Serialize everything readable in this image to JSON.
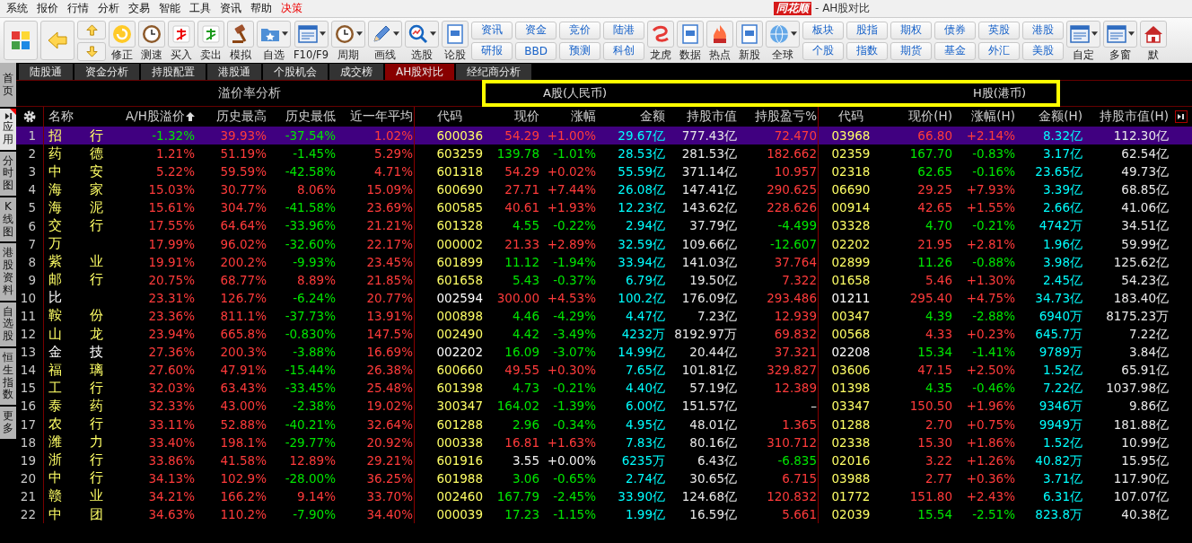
{
  "menu": [
    {
      "label": "系统",
      "highlight": false
    },
    {
      "label": "报价",
      "highlight": false
    },
    {
      "label": "行情",
      "highlight": false
    },
    {
      "label": "分析",
      "highlight": false
    },
    {
      "label": "交易",
      "highlight": false
    },
    {
      "label": "智能",
      "highlight": false
    },
    {
      "label": "工具",
      "highlight": false
    },
    {
      "label": "资讯",
      "highlight": false
    },
    {
      "label": "帮助",
      "highlight": false
    },
    {
      "label": "决策",
      "highlight": true
    }
  ],
  "title": {
    "logo": "同花顺",
    "text": "- AH股对比"
  },
  "toolbar": [
    {
      "kind": "icon"
    },
    {
      "kind": "icon"
    },
    {
      "kind": "updown"
    },
    {
      "kind": "icon",
      "label": "修正",
      "dropdown": false
    },
    {
      "kind": "icon",
      "label": "测速",
      "dropdown": false
    },
    {
      "kind": "icon",
      "label": "买入",
      "dropdown": false
    },
    {
      "kind": "icon",
      "label": "卖出",
      "dropdown": false
    },
    {
      "kind": "icon",
      "label": "模拟",
      "dropdown": false
    },
    {
      "kind": "icon",
      "label": "自选",
      "dropdown": true
    },
    {
      "kind": "icon",
      "label": "F10/F9",
      "dropdown": true
    },
    {
      "kind": "icon",
      "label": "周期",
      "dropdown": true
    },
    {
      "kind": "icon",
      "label": "画线",
      "dropdown": true
    },
    {
      "kind": "icon",
      "label": "选股",
      "dropdown": true
    },
    {
      "kind": "icon",
      "label": "论股",
      "dropdown": false
    },
    {
      "kind": "pair",
      "top": "资讯",
      "bottom": "研报"
    },
    {
      "kind": "pair",
      "top": "资金",
      "bottom": "BBD"
    },
    {
      "kind": "pair",
      "top": "竞价",
      "bottom": "预测"
    },
    {
      "kind": "pair",
      "top": "陆港",
      "bottom": "科创"
    },
    {
      "kind": "icon",
      "label": "龙虎",
      "dropdown": false
    },
    {
      "kind": "icon",
      "label": "数据",
      "dropdown": false
    },
    {
      "kind": "icon",
      "label": "热点",
      "dropdown": false
    },
    {
      "kind": "icon",
      "label": "新股",
      "dropdown": false
    },
    {
      "kind": "icon",
      "label": "全球",
      "dropdown": true
    },
    {
      "kind": "pair",
      "top": "板块",
      "bottom": "个股"
    },
    {
      "kind": "pair",
      "top": "股指",
      "bottom": "指数"
    },
    {
      "kind": "pair",
      "top": "期权",
      "bottom": "期货"
    },
    {
      "kind": "pair",
      "top": "债券",
      "bottom": "基金"
    },
    {
      "kind": "pair",
      "top": "英股",
      "bottom": "外汇"
    },
    {
      "kind": "pair",
      "top": "港股",
      "bottom": "美股"
    },
    {
      "kind": "icon",
      "label": "自定",
      "dropdown": true
    },
    {
      "kind": "icon",
      "label": "多窗",
      "dropdown": true
    },
    {
      "kind": "icon",
      "label": "默",
      "dropdown": false
    }
  ],
  "sidebar": [
    {
      "label": "首页",
      "selected": false
    },
    {
      "label": "应用",
      "selected": true
    },
    {
      "label": "分时图",
      "selected": false
    },
    {
      "label": "K线图",
      "selected": false
    },
    {
      "label": "港股资料",
      "selected": false
    },
    {
      "label": "自选股",
      "selected": false
    },
    {
      "label": "恒生指数",
      "selected": false
    },
    {
      "label": "更多",
      "selected": false
    }
  ],
  "tabs": [
    {
      "label": "陆股通",
      "selected": false
    },
    {
      "label": "资金分析",
      "selected": false
    },
    {
      "label": "持股配置",
      "selected": false
    },
    {
      "label": "港股通",
      "selected": false
    },
    {
      "label": "个股机会",
      "selected": false
    },
    {
      "label": "成交榜",
      "selected": false
    },
    {
      "label": "AH股对比",
      "selected": true
    },
    {
      "label": "经纪商分析",
      "selected": false
    }
  ],
  "band": {
    "title": "溢价率分析",
    "group_a": "A股(人民币)",
    "group_h": "H股(港币)"
  },
  "columns": [
    {
      "label": "名称",
      "sorted": false
    },
    {
      "label": "A/H股溢价",
      "sorted": true
    },
    {
      "label": "历史最高",
      "sorted": false
    },
    {
      "label": "历史最低",
      "sorted": false
    },
    {
      "label": "近一年平均",
      "sorted": false
    },
    {
      "label": "代码",
      "sorted": false
    },
    {
      "label": "现价",
      "sorted": false
    },
    {
      "label": "涨幅",
      "sorted": false
    },
    {
      "label": "金额",
      "sorted": false
    },
    {
      "label": "持股市值",
      "sorted": false
    },
    {
      "label": "持股盈亏%",
      "sorted": false
    },
    {
      "label": "代码",
      "sorted": false
    },
    {
      "label": "现价(H)",
      "sorted": false
    },
    {
      "label": "涨幅(H)",
      "sorted": false
    },
    {
      "label": "金额(H)",
      "sorted": false
    },
    {
      "label": "持股市值(H)",
      "sorted": false
    }
  ],
  "rows": [
    {
      "num": "1",
      "name_start": "招",
      "name_end": "行",
      "premium": "-1.32%",
      "hist_high": "39.93%",
      "hist_low": "-37.54%",
      "avg_1y": "1.02%",
      "a_code": "600036",
      "a_price": "54.29",
      "a_change": "+1.00%",
      "a_amount": "29.67亿",
      "a_mv": "777.43亿",
      "a_pnl": "72.470",
      "h_code": "03968",
      "h_price": "66.80",
      "h_change": "+2.14%",
      "h_amount": "8.32亿",
      "h_mv": "112.30亿",
      "tinted": true,
      "selected": true
    },
    {
      "num": "2",
      "name_start": "药",
      "name_end": "德",
      "premium": "1.21%",
      "hist_high": "51.19%",
      "hist_low": "-1.45%",
      "avg_1y": "5.29%",
      "a_code": "603259",
      "a_price": "139.78",
      "a_change": "-1.01%",
      "a_amount": "28.53亿",
      "a_mv": "281.53亿",
      "a_pnl": "182.662",
      "h_code": "02359",
      "h_price": "167.70",
      "h_change": "-0.83%",
      "h_amount": "3.17亿",
      "h_mv": "62.54亿",
      "tinted": true,
      "selected": false
    },
    {
      "num": "3",
      "name_start": "中",
      "name_end": "安",
      "premium": "5.22%",
      "hist_high": "59.59%",
      "hist_low": "-42.58%",
      "avg_1y": "4.71%",
      "a_code": "601318",
      "a_price": "54.29",
      "a_change": "+0.02%",
      "a_amount": "55.59亿",
      "a_mv": "371.14亿",
      "a_pnl": "10.957",
      "h_code": "02318",
      "h_price": "62.65",
      "h_change": "-0.16%",
      "h_amount": "23.65亿",
      "h_mv": "49.73亿",
      "tinted": true,
      "selected": false
    },
    {
      "num": "4",
      "name_start": "海",
      "name_end": "家",
      "premium": "15.03%",
      "hist_high": "30.77%",
      "hist_low": "8.06%",
      "avg_1y": "15.09%",
      "a_code": "600690",
      "a_price": "27.71",
      "a_change": "+7.44%",
      "a_amount": "26.08亿",
      "a_mv": "147.41亿",
      "a_pnl": "290.625",
      "h_code": "06690",
      "h_price": "29.25",
      "h_change": "+7.93%",
      "h_amount": "3.39亿",
      "h_mv": "68.85亿",
      "tinted": true,
      "selected": false
    },
    {
      "num": "5",
      "name_start": "海",
      "name_end": "泥",
      "premium": "15.61%",
      "hist_high": "304.7%",
      "hist_low": "-41.58%",
      "avg_1y": "23.69%",
      "a_code": "600585",
      "a_price": "40.61",
      "a_change": "+1.93%",
      "a_amount": "12.23亿",
      "a_mv": "143.62亿",
      "a_pnl": "228.626",
      "h_code": "00914",
      "h_price": "42.65",
      "h_change": "+1.55%",
      "h_amount": "2.66亿",
      "h_mv": "41.06亿",
      "tinted": true,
      "selected": false
    },
    {
      "num": "6",
      "name_start": "交",
      "name_end": "行",
      "premium": "17.55%",
      "hist_high": "64.64%",
      "hist_low": "-33.96%",
      "avg_1y": "21.21%",
      "a_code": "601328",
      "a_price": "4.55",
      "a_change": "-0.22%",
      "a_amount": "2.94亿",
      "a_mv": "37.79亿",
      "a_pnl": "-4.499",
      "h_code": "03328",
      "h_price": "4.70",
      "h_change": "-0.21%",
      "h_amount": "4742万",
      "h_mv": "34.51亿",
      "tinted": true,
      "selected": false
    },
    {
      "num": "7",
      "name_start": "万",
      "premium": "17.99%",
      "hist_high": "96.02%",
      "hist_low": "-32.60%",
      "avg_1y": "22.17%",
      "a_code": "000002",
      "a_price": "21.33",
      "a_change": "+2.89%",
      "a_amount": "32.59亿",
      "a_mv": "109.66亿",
      "a_pnl": "-12.607",
      "h_code": "02202",
      "h_price": "21.95",
      "h_change": "+2.81%",
      "h_amount": "1.96亿",
      "h_mv": "59.99亿",
      "tinted": true,
      "selected": false
    },
    {
      "num": "8",
      "name_start": "紫",
      "name_end": "业",
      "premium": "19.91%",
      "hist_high": "200.2%",
      "hist_low": "-9.93%",
      "avg_1y": "23.45%",
      "a_code": "601899",
      "a_price": "11.12",
      "a_change": "-1.94%",
      "a_amount": "33.94亿",
      "a_mv": "141.03亿",
      "a_pnl": "37.764",
      "h_code": "02899",
      "h_price": "11.26",
      "h_change": "-0.88%",
      "h_amount": "3.98亿",
      "h_mv": "125.62亿",
      "tinted": true,
      "selected": false
    },
    {
      "num": "9",
      "name_start": "邮",
      "name_end": "行",
      "premium": "20.75%",
      "hist_high": "68.77%",
      "hist_low": "8.89%",
      "avg_1y": "21.85%",
      "a_code": "601658",
      "a_price": "5.43",
      "a_change": "-0.37%",
      "a_amount": "6.79亿",
      "a_mv": "19.50亿",
      "a_pnl": "7.322",
      "h_code": "01658",
      "h_price": "5.46",
      "h_change": "+1.30%",
      "h_amount": "2.45亿",
      "h_mv": "54.23亿",
      "tinted": true,
      "selected": false
    },
    {
      "num": "10",
      "name_start": "比",
      "premium": "23.31%",
      "hist_high": "126.7%",
      "hist_low": "-6.24%",
      "avg_1y": "20.77%",
      "a_code": "002594",
      "a_price": "300.00",
      "a_change": "+4.53%",
      "a_amount": "100.2亿",
      "a_mv": "176.09亿",
      "a_pnl": "293.486",
      "h_code": "01211",
      "h_price": "295.40",
      "h_change": "+4.75%",
      "h_amount": "34.73亿",
      "h_mv": "183.40亿",
      "tinted": false,
      "selected": false
    },
    {
      "num": "11",
      "name_start": "鞍",
      "name_end": "份",
      "premium": "23.36%",
      "hist_high": "811.1%",
      "hist_low": "-37.73%",
      "avg_1y": "13.91%",
      "a_code": "000898",
      "a_price": "4.46",
      "a_change": "-4.29%",
      "a_amount": "4.47亿",
      "a_mv": "7.23亿",
      "a_pnl": "12.939",
      "h_code": "00347",
      "h_price": "4.39",
      "h_change": "-2.88%",
      "h_amount": "6940万",
      "h_mv": "8175.23万",
      "tinted": true,
      "selected": false
    },
    {
      "num": "12",
      "name_start": "山",
      "name_end": "龙",
      "premium": "23.94%",
      "hist_high": "665.8%",
      "hist_low": "-0.830%",
      "avg_1y": "147.5%",
      "a_code": "002490",
      "a_price": "4.42",
      "a_change": "-3.49%",
      "a_amount": "4232万",
      "a_mv": "8192.97万",
      "a_pnl": "69.832",
      "h_code": "00568",
      "h_price": "4.33",
      "h_change": "+0.23%",
      "h_amount": "645.7万",
      "h_mv": "7.22亿",
      "tinted": true,
      "selected": false
    },
    {
      "num": "13",
      "name_start": "金",
      "name_end": "技",
      "premium": "27.36%",
      "hist_high": "200.3%",
      "hist_low": "-3.88%",
      "avg_1y": "16.69%",
      "a_code": "002202",
      "a_price": "16.09",
      "a_change": "-3.07%",
      "a_amount": "14.99亿",
      "a_mv": "20.44亿",
      "a_pnl": "37.321",
      "h_code": "02208",
      "h_price": "15.34",
      "h_change": "-1.41%",
      "h_amount": "9789万",
      "h_mv": "3.84亿",
      "tinted": false,
      "selected": false
    },
    {
      "num": "14",
      "name_start": "福",
      "name_end": "璃",
      "premium": "27.60%",
      "hist_high": "47.91%",
      "hist_low": "-15.44%",
      "avg_1y": "26.38%",
      "a_code": "600660",
      "a_price": "49.55",
      "a_change": "+0.30%",
      "a_amount": "7.65亿",
      "a_mv": "101.81亿",
      "a_pnl": "329.827",
      "h_code": "03606",
      "h_price": "47.15",
      "h_change": "+2.50%",
      "h_amount": "1.52亿",
      "h_mv": "65.91亿",
      "tinted": true,
      "selected": false
    },
    {
      "num": "15",
      "name_start": "工",
      "name_end": "行",
      "premium": "32.03%",
      "hist_high": "63.43%",
      "hist_low": "-33.45%",
      "avg_1y": "25.48%",
      "a_code": "601398",
      "a_price": "4.73",
      "a_change": "-0.21%",
      "a_amount": "4.40亿",
      "a_mv": "57.19亿",
      "a_pnl": "12.389",
      "h_code": "01398",
      "h_price": "4.35",
      "h_change": "-0.46%",
      "h_amount": "7.22亿",
      "h_mv": "1037.98亿",
      "tinted": true,
      "selected": false
    },
    {
      "num": "16",
      "name_start": "泰",
      "name_end": "药",
      "premium": "32.33%",
      "hist_high": "43.00%",
      "hist_low": "-2.38%",
      "avg_1y": "19.02%",
      "a_code": "300347",
      "a_price": "164.02",
      "a_change": "-1.39%",
      "a_amount": "6.00亿",
      "a_mv": "151.57亿",
      "a_pnl": "–",
      "h_code": "03347",
      "h_price": "150.50",
      "h_change": "+1.96%",
      "h_amount": "9346万",
      "h_mv": "9.86亿",
      "tinted": true,
      "selected": false
    },
    {
      "num": "17",
      "name_start": "农",
      "name_end": "行",
      "premium": "33.11%",
      "hist_high": "52.88%",
      "hist_low": "-40.21%",
      "avg_1y": "32.64%",
      "a_code": "601288",
      "a_price": "2.96",
      "a_change": "-0.34%",
      "a_amount": "4.95亿",
      "a_mv": "48.01亿",
      "a_pnl": "1.365",
      "h_code": "01288",
      "h_price": "2.70",
      "h_change": "+0.75%",
      "h_amount": "9949万",
      "h_mv": "181.88亿",
      "tinted": true,
      "selected": false
    },
    {
      "num": "18",
      "name_start": "潍",
      "name_end": "力",
      "premium": "33.40%",
      "hist_high": "198.1%",
      "hist_low": "-29.77%",
      "avg_1y": "20.92%",
      "a_code": "000338",
      "a_price": "16.81",
      "a_change": "+1.63%",
      "a_amount": "7.83亿",
      "a_mv": "80.16亿",
      "a_pnl": "310.712",
      "h_code": "02338",
      "h_price": "15.30",
      "h_change": "+1.86%",
      "h_amount": "1.52亿",
      "h_mv": "10.99亿",
      "tinted": true,
      "selected": false
    },
    {
      "num": "19",
      "name_start": "浙",
      "name_end": "行",
      "premium": "33.86%",
      "hist_high": "41.58%",
      "hist_low": "12.89%",
      "avg_1y": "29.21%",
      "a_code": "601916",
      "a_price": "3.55",
      "a_change": "+0.00%",
      "a_amount": "6235万",
      "a_mv": "6.43亿",
      "a_pnl": "-6.835",
      "h_code": "02016",
      "h_price": "3.22",
      "h_change": "+1.26%",
      "h_amount": "40.82万",
      "h_mv": "15.95亿",
      "tinted": true,
      "selected": false
    },
    {
      "num": "20",
      "name_start": "中",
      "name_end": "行",
      "premium": "34.13%",
      "hist_high": "102.9%",
      "hist_low": "-28.00%",
      "avg_1y": "36.25%",
      "a_code": "601988",
      "a_price": "3.06",
      "a_change": "-0.65%",
      "a_amount": "2.74亿",
      "a_mv": "30.65亿",
      "a_pnl": "6.715",
      "h_code": "03988",
      "h_price": "2.77",
      "h_change": "+0.36%",
      "h_amount": "3.71亿",
      "h_mv": "117.90亿",
      "tinted": true,
      "selected": false
    },
    {
      "num": "21",
      "name_start": "赣",
      "name_end": "业",
      "premium": "34.21%",
      "hist_high": "166.2%",
      "hist_low": "9.14%",
      "avg_1y": "33.70%",
      "a_code": "002460",
      "a_price": "167.79",
      "a_change": "-2.45%",
      "a_amount": "33.90亿",
      "a_mv": "124.68亿",
      "a_pnl": "120.832",
      "h_code": "01772",
      "h_price": "151.80",
      "h_change": "+2.43%",
      "h_amount": "6.31亿",
      "h_mv": "107.07亿",
      "tinted": true,
      "selected": false
    },
    {
      "num": "22",
      "name_start": "中",
      "name_end": "团",
      "premium": "34.63%",
      "hist_high": "110.2%",
      "hist_low": "-7.90%",
      "avg_1y": "34.40%",
      "a_code": "000039",
      "a_price": "17.23",
      "a_change": "-1.15%",
      "a_amount": "1.99亿",
      "a_mv": "16.59亿",
      "a_pnl": "5.661",
      "h_code": "02039",
      "h_price": "15.54",
      "h_change": "-2.51%",
      "h_amount": "823.8万",
      "h_mv": "40.38亿",
      "tinted": true,
      "selected": false
    }
  ]
}
